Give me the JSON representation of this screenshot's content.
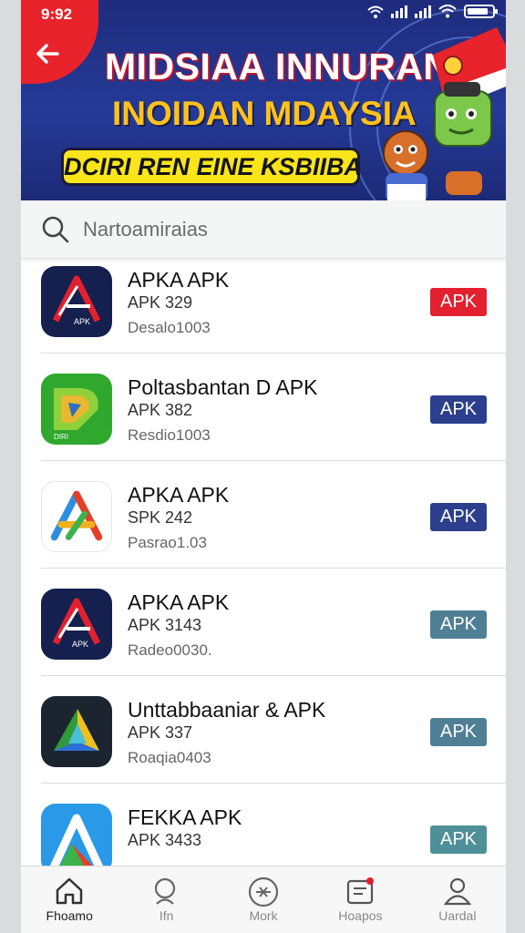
{
  "status_bar": {
    "time": "9:92"
  },
  "banner": {
    "line1": "MIDSIAA INNURAN",
    "line2": "INOIDAN MDAYSIA",
    "pill": "DCIRI REN EINE KSBIIBA!"
  },
  "search": {
    "placeholder": "Nartoamiraias"
  },
  "apps": [
    {
      "name": "APKA APK",
      "version": "APK 329",
      "downloads": "Desalo1003",
      "button": "APK",
      "button_color": "#e3202f",
      "icon": "navy-a-logo"
    },
    {
      "name": "Poltasbantan D APK",
      "version": "APK 382",
      "downloads": "Resdio1003",
      "button": "APK",
      "button_color": "#2b3f8c",
      "icon": "green-d-logo"
    },
    {
      "name": "APKA APK",
      "version": "SPK 242",
      "downloads": "Pasrao1.03",
      "button": "APK",
      "button_color": "#2b3f8c",
      "icon": "multicolor-a-logo"
    },
    {
      "name": "APKA APK",
      "version": "APK 3143",
      "downloads": "Radeo0030.",
      "button": "APK",
      "button_color": "#4f7f95",
      "icon": "navy-a-logo"
    },
    {
      "name": "Unttabbaaniar & APK",
      "version": "APK 337",
      "downloads": "Roaqia0403",
      "button": "APK",
      "button_color": "#4f7f95",
      "icon": "dark-triangle-logo"
    },
    {
      "name": "FEKKA APK",
      "version": "APK 3433",
      "downloads": "",
      "button": "APK",
      "button_color": "#4f8f98",
      "icon": "blue-a-logo"
    }
  ],
  "nav": [
    {
      "label": "Fhoamo",
      "icon": "home-icon",
      "active": true
    },
    {
      "label": "Ifn",
      "icon": "search-icon",
      "active": false
    },
    {
      "label": "Mork",
      "icon": "compass-icon",
      "active": false
    },
    {
      "label": "Hoapos",
      "icon": "inbox-icon",
      "active": false
    },
    {
      "label": "Uardal",
      "icon": "user-icon",
      "active": false
    }
  ],
  "colors": {
    "banner_blue": "#243a96",
    "accent_red": "#e3202f",
    "accent_navy": "#2b3f8c",
    "accent_teal": "#4f7f95"
  }
}
